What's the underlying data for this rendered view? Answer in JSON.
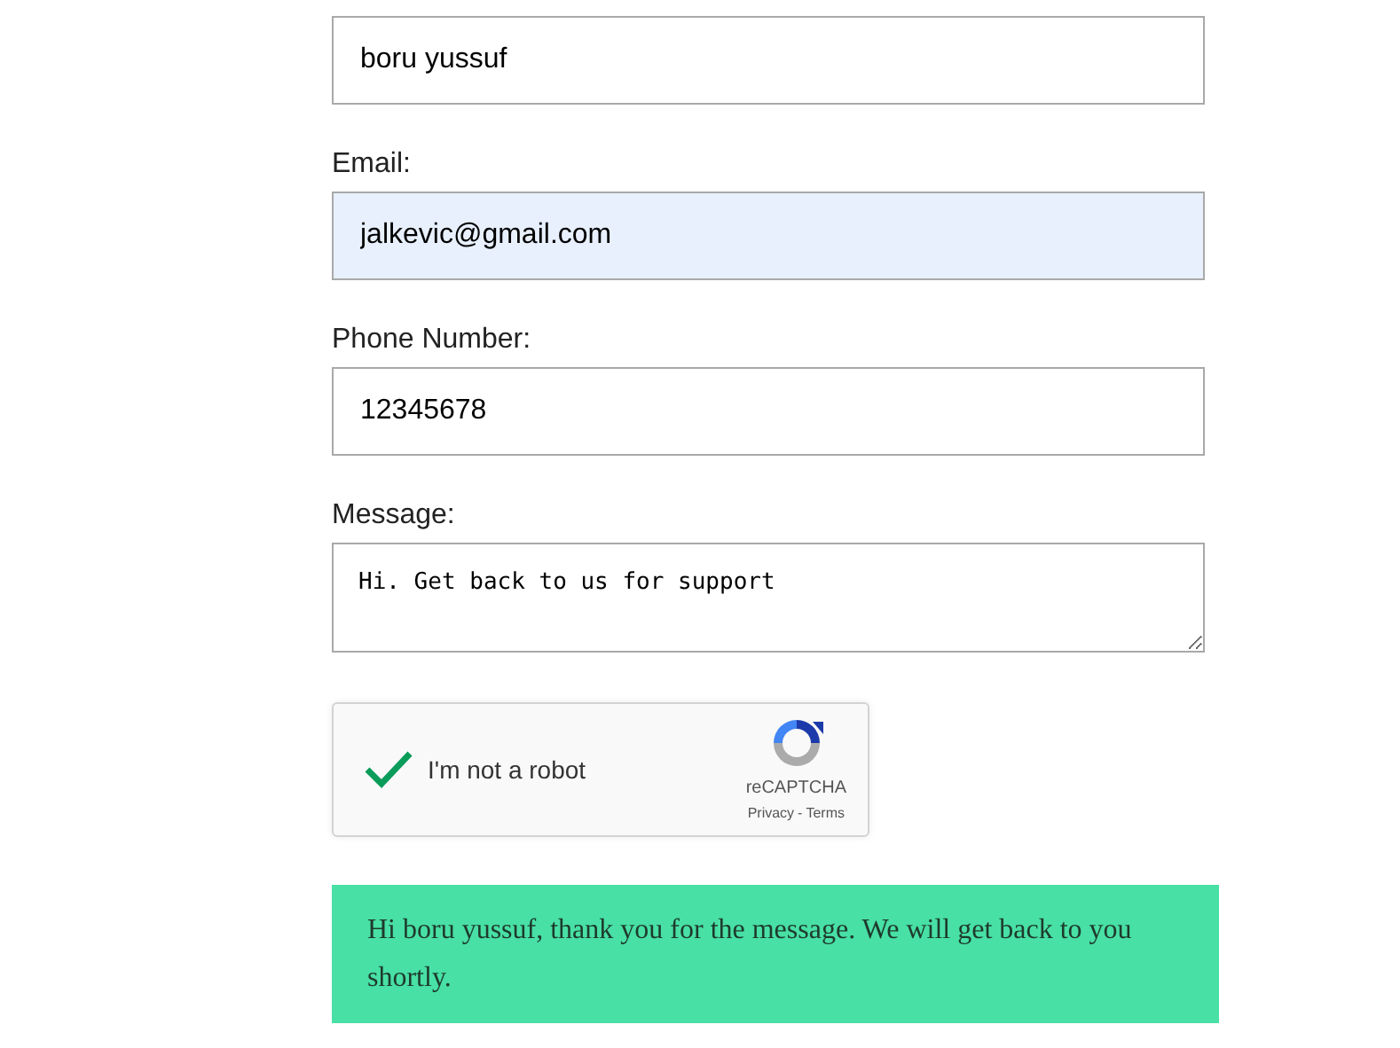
{
  "fields": [
    {
      "kind": "input",
      "value": "boru yussuf",
      "autofilled": false
    },
    {
      "kind": "input",
      "label": "Email:",
      "value": "jalkevic@gmail.com",
      "autofilled": true
    },
    {
      "kind": "input",
      "label": "Phone Number:",
      "value": "12345678",
      "autofilled": false
    },
    {
      "kind": "textarea",
      "label": "Message:",
      "value": "Hi. Get back to us for support",
      "autofilled": false
    }
  ],
  "captcha": {
    "checked": true,
    "label": "I'm not a robot",
    "brand": "reCAPTCHA",
    "links": [
      "Privacy",
      "Terms"
    ],
    "separator": "-"
  },
  "success_message": "Hi boru yussuf, thank you for the message. We will get back to you shortly."
}
